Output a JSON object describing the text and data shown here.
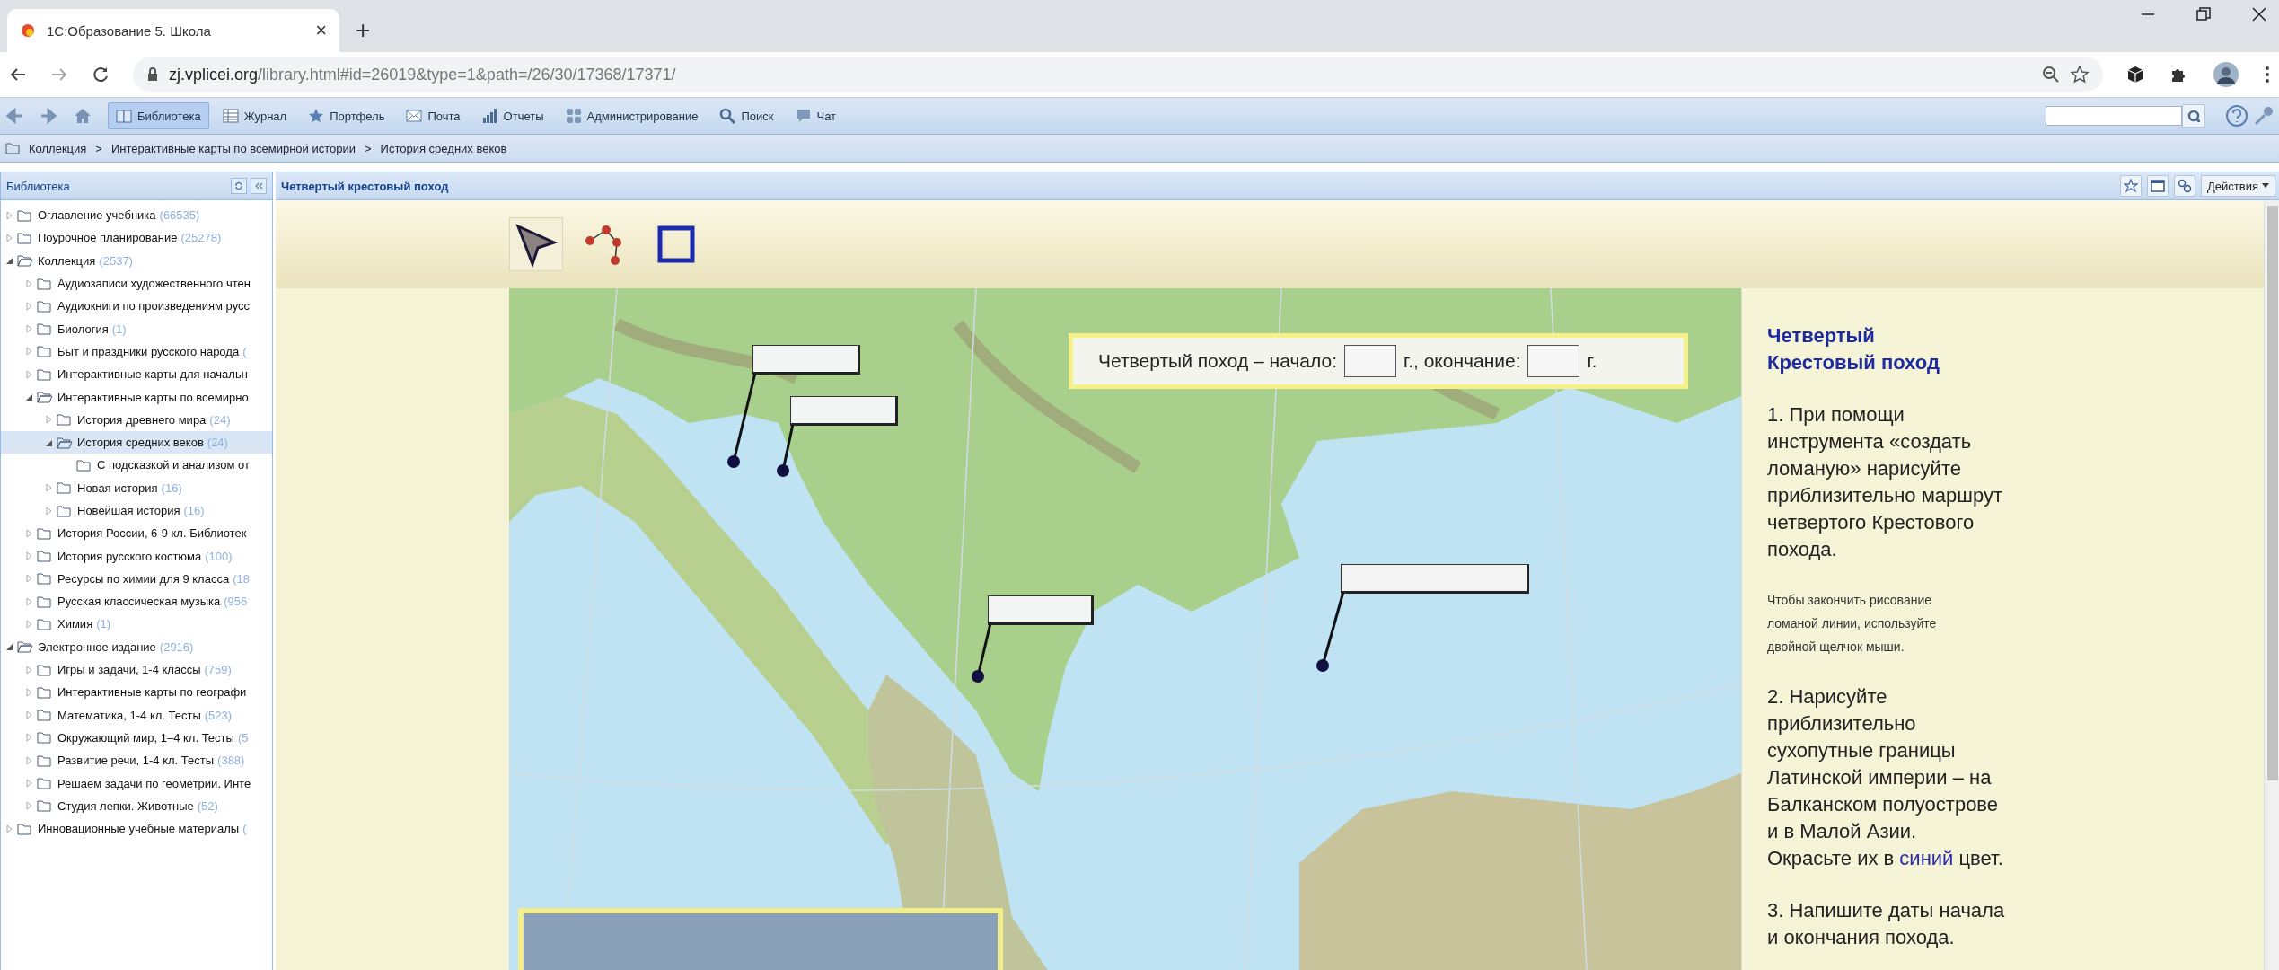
{
  "browser": {
    "tab": {
      "title": "1С:Образование 5. Школа",
      "close": "×"
    },
    "new_tab": "+",
    "url": {
      "host": "zj.vplicei.org",
      "path": "/library.html#id=26019&type=1&path=/26/30/17368/17371/"
    }
  },
  "toolbar": {
    "items": [
      {
        "label": "Библиотека",
        "selected": true
      },
      {
        "label": "Журнал",
        "selected": false
      },
      {
        "label": "Портфель",
        "selected": false
      },
      {
        "label": "Почта",
        "selected": false
      },
      {
        "label": "Отчеты",
        "selected": false
      },
      {
        "label": "Администрирование",
        "selected": false
      },
      {
        "label": "Поиск",
        "selected": false
      },
      {
        "label": "Чат",
        "selected": false
      }
    ]
  },
  "breadcrumb": [
    {
      "label": "Коллекция"
    },
    {
      "label": "Интерактивные карты по всемирной истории"
    },
    {
      "label": "История средних веков"
    }
  ],
  "breadcrumb_separator": ">",
  "sidebar": {
    "title": "Библиотека",
    "items": [
      {
        "label": "Оглавление учебника",
        "count": "(66535)",
        "kind": "branch",
        "expanded": false,
        "selected": false
      },
      {
        "label": "Поурочное планирование",
        "count": "(25278)",
        "kind": "branch",
        "expanded": false,
        "selected": false
      },
      {
        "label": "Коллекция",
        "count": "(2537)",
        "kind": "branch",
        "expanded": true,
        "selected": false,
        "children": [
          {
            "label": "Аудиозаписи художественного чтен",
            "kind": "branch",
            "expanded": false,
            "selected": false
          },
          {
            "label": "Аудиокниги по произведениям русс",
            "kind": "branch",
            "expanded": false,
            "selected": false
          },
          {
            "label": "Биология",
            "count": "(1)",
            "kind": "branch",
            "expanded": false,
            "selected": false
          },
          {
            "label": "Быт и праздники русского народа",
            "count": "(",
            "kind": "branch",
            "expanded": false,
            "selected": false
          },
          {
            "label": "Интерактивные карты для начальн",
            "kind": "branch",
            "expanded": false,
            "selected": false
          },
          {
            "label": "Интерактивные карты по всемирно",
            "kind": "branch",
            "expanded": true,
            "selected": false,
            "children": [
              {
                "label": "История древнего мира",
                "count": "(24)",
                "kind": "branch",
                "expanded": false,
                "selected": false
              },
              {
                "label": "История средних веков",
                "count": "(24)",
                "kind": "branch",
                "expanded": true,
                "selected": true,
                "children": [
                  {
                    "label": "С подсказкой и анализом от",
                    "kind": "leaf",
                    "selected": false
                  }
                ]
              },
              {
                "label": "Новая история",
                "count": "(16)",
                "kind": "branch",
                "expanded": false,
                "selected": false
              },
              {
                "label": "Новейшая история",
                "count": "(16)",
                "kind": "branch",
                "expanded": false,
                "selected": false
              }
            ]
          },
          {
            "label": "История России, 6-9 кл. Библиотек",
            "kind": "branch",
            "expanded": false,
            "selected": false
          },
          {
            "label": "История русского костюма",
            "count": "(100)",
            "kind": "branch",
            "expanded": false,
            "selected": false
          },
          {
            "label": "Ресурсы по химии для 9 класса",
            "count": "(18",
            "kind": "branch",
            "expanded": false,
            "selected": false
          },
          {
            "label": "Русская классическая музыка",
            "count": "(956",
            "kind": "branch",
            "expanded": false,
            "selected": false
          },
          {
            "label": "Химия",
            "count": "(1)",
            "kind": "branch",
            "expanded": false,
            "selected": false
          }
        ]
      },
      {
        "label": "Электронное издание",
        "count": "(2916)",
        "kind": "branch",
        "expanded": true,
        "selected": false,
        "children": [
          {
            "label": "Игры и задачи, 1-4 классы",
            "count": "(759)",
            "kind": "branch",
            "expanded": false,
            "selected": false
          },
          {
            "label": "Интерактивные карты по географи",
            "kind": "branch",
            "expanded": false,
            "selected": false
          },
          {
            "label": "Математика, 1-4 кл. Тесты",
            "count": "(523)",
            "kind": "branch",
            "expanded": false,
            "selected": false
          },
          {
            "label": "Окружающий мир, 1–4 кл. Тесты",
            "count": "(5",
            "kind": "branch",
            "expanded": false,
            "selected": false
          },
          {
            "label": "Развитие речи, 1-4 кл. Тесты",
            "count": "(388)",
            "kind": "branch",
            "expanded": false,
            "selected": false
          },
          {
            "label": "Решаем задачи по геометрии. Инте",
            "kind": "branch",
            "expanded": false,
            "selected": false
          },
          {
            "label": "Студия лепки. Животные",
            "count": "(52)",
            "kind": "branch",
            "expanded": false,
            "selected": false
          }
        ]
      },
      {
        "label": "Инновационные учебные материалы",
        "count": "(",
        "kind": "branch",
        "expanded": false,
        "selected": false
      }
    ]
  },
  "document": {
    "title": "Четвертый крестовый поход",
    "actions_button": "Действия",
    "tools": [
      {
        "selected": true
      },
      {
        "selected": false
      },
      {
        "selected": false
      }
    ],
    "map": {
      "dates_box": {
        "start_label": "Четвертый поход – начало:",
        "middle_label": "г., окончание:",
        "end_label": "г."
      }
    },
    "instructions": {
      "heading": "Четвертый\nКрестовый поход",
      "paragraphs": [
        {
          "kind": "main",
          "segments": [
            {
              "text": "1. При помощи\nинструмента «создать\nломаную» нарисуйте\nприблизительно маршрут\nчетвертого Крестового\nпохода."
            }
          ]
        },
        {
          "kind": "note",
          "segments": [
            {
              "text": "Чтобы закончить рисование\nломаной линии, используйте\nдвойной щелчок мыши."
            }
          ]
        },
        {
          "kind": "main",
          "segments": [
            {
              "text": "2. Нарисуйте\nприблизительно\nсухопутные границы\nЛатинской империи – на\nБалканском полуострове\nи в Малой Азии.\nОкрасьте их в "
            },
            {
              "text": "синий",
              "color": "#2a2aa8"
            },
            {
              "text": " цвет."
            }
          ]
        },
        {
          "kind": "main",
          "segments": [
            {
              "text": "3. Напишите даты начала\nи окончания похода."
            }
          ]
        }
      ]
    }
  }
}
